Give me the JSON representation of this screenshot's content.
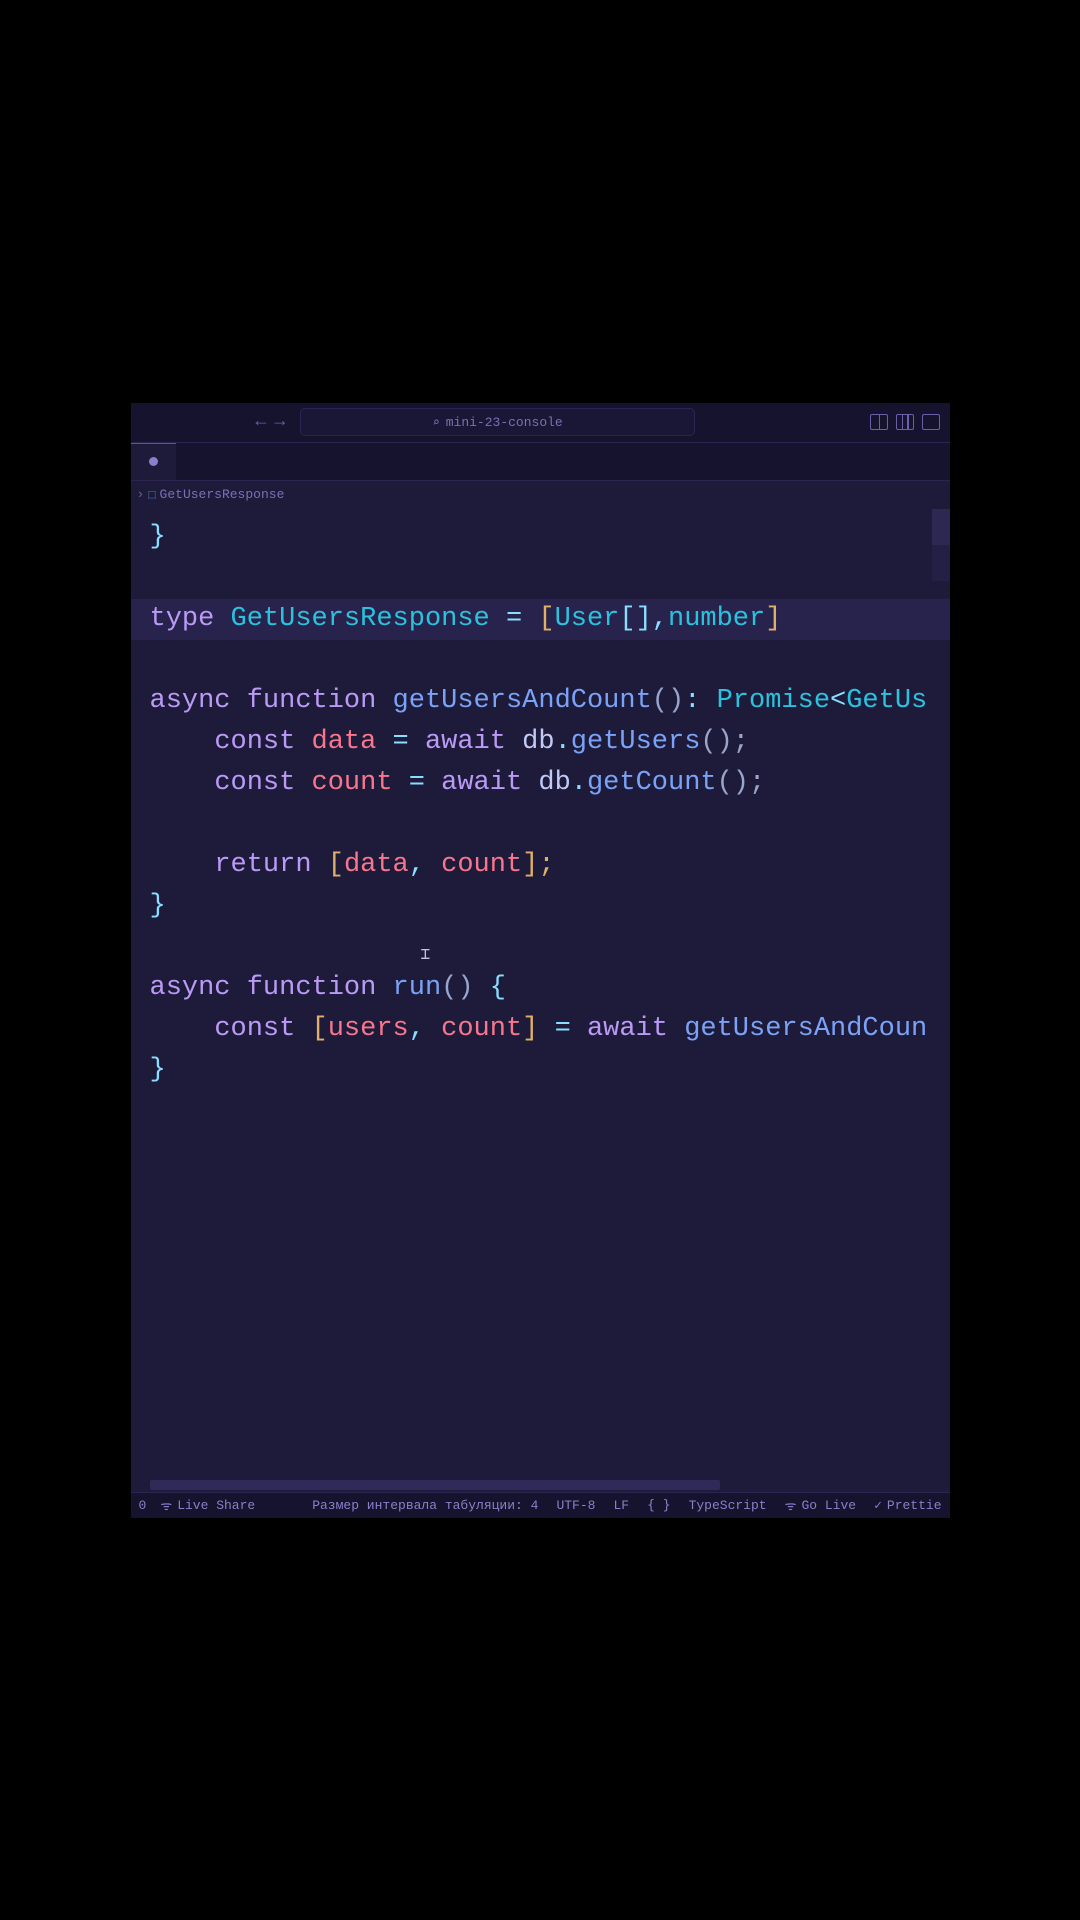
{
  "titlebar": {
    "search_placeholder": "mini-23-console"
  },
  "breadcrumb": {
    "sep": "›",
    "symbol": "GetUsersResponse"
  },
  "code": {
    "l1a": "type",
    "l1b": "GetUsersResponse",
    "l1c": "=",
    "l1d": "[",
    "l1e": "User",
    "l1f": "[]",
    "l1g": ",",
    "l1h": "number",
    "l1i": "]",
    "l2a": "async",
    "l2b": "function",
    "l2c": "getUsersAndCount",
    "l2d": "()",
    "l2e": ":",
    "l2f": "Promise",
    "l2g": "<",
    "l2h": "GetUs",
    "l3a": "const",
    "l3b": "data",
    "l3c": "=",
    "l3d": "await",
    "l3e": "db",
    "l3f": ".",
    "l3g": "getUsers",
    "l3h": "();",
    "l4a": "const",
    "l4b": "count",
    "l4c": "=",
    "l4d": "await",
    "l4e": "db",
    "l4f": ".",
    "l4g": "getCount",
    "l4h": "();",
    "l5a": "return",
    "l5b": "[",
    "l5c": "data",
    "l5d": ",",
    "l5e": "count",
    "l5f": "];",
    "l6a": "}",
    "l7a": "async",
    "l7b": "function",
    "l7c": "run",
    "l7d": "()",
    "l7e": "{",
    "l8a": "const",
    "l8b": "[",
    "l8c": "users",
    "l8d": ",",
    "l8e": "count",
    "l8f": "]",
    "l8g": "=",
    "l8h": "await",
    "l8i": "getUsersAndCoun",
    "l9a": "}"
  },
  "status": {
    "num": "0",
    "liveshare": "Live Share",
    "tabsize": "Размер интервала табуляции: 4",
    "encoding": "UTF-8",
    "eol": "LF",
    "lang": "TypeScript",
    "golive": "Go Live",
    "prettier": "Prettie"
  }
}
